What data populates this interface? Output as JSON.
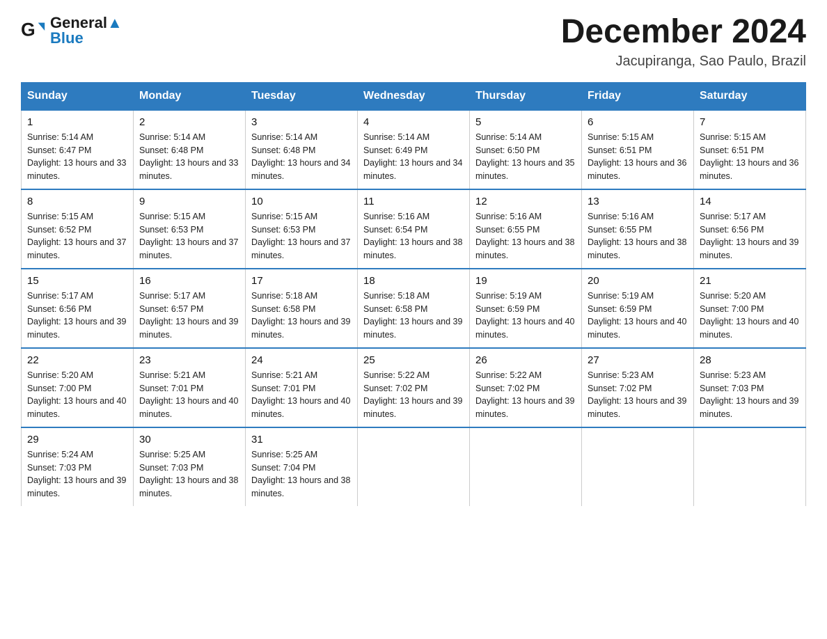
{
  "header": {
    "logo_general": "General",
    "logo_blue": "Blue",
    "month_title": "December 2024",
    "location": "Jacupiranga, Sao Paulo, Brazil"
  },
  "days_of_week": [
    "Sunday",
    "Monday",
    "Tuesday",
    "Wednesday",
    "Thursday",
    "Friday",
    "Saturday"
  ],
  "weeks": [
    [
      {
        "day": "1",
        "sunrise": "5:14 AM",
        "sunset": "6:47 PM",
        "daylight": "13 hours and 33 minutes."
      },
      {
        "day": "2",
        "sunrise": "5:14 AM",
        "sunset": "6:48 PM",
        "daylight": "13 hours and 33 minutes."
      },
      {
        "day": "3",
        "sunrise": "5:14 AM",
        "sunset": "6:48 PM",
        "daylight": "13 hours and 34 minutes."
      },
      {
        "day": "4",
        "sunrise": "5:14 AM",
        "sunset": "6:49 PM",
        "daylight": "13 hours and 34 minutes."
      },
      {
        "day": "5",
        "sunrise": "5:14 AM",
        "sunset": "6:50 PM",
        "daylight": "13 hours and 35 minutes."
      },
      {
        "day": "6",
        "sunrise": "5:15 AM",
        "sunset": "6:51 PM",
        "daylight": "13 hours and 36 minutes."
      },
      {
        "day": "7",
        "sunrise": "5:15 AM",
        "sunset": "6:51 PM",
        "daylight": "13 hours and 36 minutes."
      }
    ],
    [
      {
        "day": "8",
        "sunrise": "5:15 AM",
        "sunset": "6:52 PM",
        "daylight": "13 hours and 37 minutes."
      },
      {
        "day": "9",
        "sunrise": "5:15 AM",
        "sunset": "6:53 PM",
        "daylight": "13 hours and 37 minutes."
      },
      {
        "day": "10",
        "sunrise": "5:15 AM",
        "sunset": "6:53 PM",
        "daylight": "13 hours and 37 minutes."
      },
      {
        "day": "11",
        "sunrise": "5:16 AM",
        "sunset": "6:54 PM",
        "daylight": "13 hours and 38 minutes."
      },
      {
        "day": "12",
        "sunrise": "5:16 AM",
        "sunset": "6:55 PM",
        "daylight": "13 hours and 38 minutes."
      },
      {
        "day": "13",
        "sunrise": "5:16 AM",
        "sunset": "6:55 PM",
        "daylight": "13 hours and 38 minutes."
      },
      {
        "day": "14",
        "sunrise": "5:17 AM",
        "sunset": "6:56 PM",
        "daylight": "13 hours and 39 minutes."
      }
    ],
    [
      {
        "day": "15",
        "sunrise": "5:17 AM",
        "sunset": "6:56 PM",
        "daylight": "13 hours and 39 minutes."
      },
      {
        "day": "16",
        "sunrise": "5:17 AM",
        "sunset": "6:57 PM",
        "daylight": "13 hours and 39 minutes."
      },
      {
        "day": "17",
        "sunrise": "5:18 AM",
        "sunset": "6:58 PM",
        "daylight": "13 hours and 39 minutes."
      },
      {
        "day": "18",
        "sunrise": "5:18 AM",
        "sunset": "6:58 PM",
        "daylight": "13 hours and 39 minutes."
      },
      {
        "day": "19",
        "sunrise": "5:19 AM",
        "sunset": "6:59 PM",
        "daylight": "13 hours and 40 minutes."
      },
      {
        "day": "20",
        "sunrise": "5:19 AM",
        "sunset": "6:59 PM",
        "daylight": "13 hours and 40 minutes."
      },
      {
        "day": "21",
        "sunrise": "5:20 AM",
        "sunset": "7:00 PM",
        "daylight": "13 hours and 40 minutes."
      }
    ],
    [
      {
        "day": "22",
        "sunrise": "5:20 AM",
        "sunset": "7:00 PM",
        "daylight": "13 hours and 40 minutes."
      },
      {
        "day": "23",
        "sunrise": "5:21 AM",
        "sunset": "7:01 PM",
        "daylight": "13 hours and 40 minutes."
      },
      {
        "day": "24",
        "sunrise": "5:21 AM",
        "sunset": "7:01 PM",
        "daylight": "13 hours and 40 minutes."
      },
      {
        "day": "25",
        "sunrise": "5:22 AM",
        "sunset": "7:02 PM",
        "daylight": "13 hours and 39 minutes."
      },
      {
        "day": "26",
        "sunrise": "5:22 AM",
        "sunset": "7:02 PM",
        "daylight": "13 hours and 39 minutes."
      },
      {
        "day": "27",
        "sunrise": "5:23 AM",
        "sunset": "7:02 PM",
        "daylight": "13 hours and 39 minutes."
      },
      {
        "day": "28",
        "sunrise": "5:23 AM",
        "sunset": "7:03 PM",
        "daylight": "13 hours and 39 minutes."
      }
    ],
    [
      {
        "day": "29",
        "sunrise": "5:24 AM",
        "sunset": "7:03 PM",
        "daylight": "13 hours and 39 minutes."
      },
      {
        "day": "30",
        "sunrise": "5:25 AM",
        "sunset": "7:03 PM",
        "daylight": "13 hours and 38 minutes."
      },
      {
        "day": "31",
        "sunrise": "5:25 AM",
        "sunset": "7:04 PM",
        "daylight": "13 hours and 38 minutes."
      },
      null,
      null,
      null,
      null
    ]
  ]
}
